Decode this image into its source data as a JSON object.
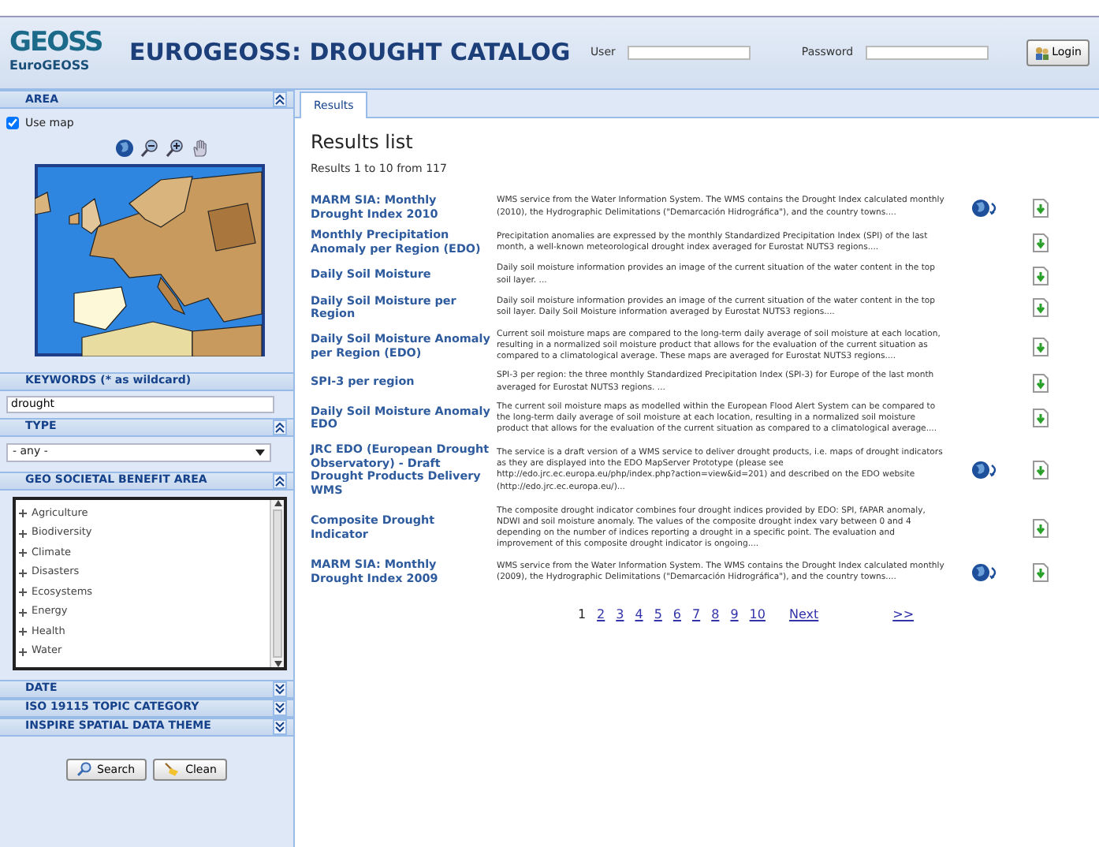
{
  "header": {
    "logo_text": "GEOSS",
    "logo_subtitle": "EuroGEOSS",
    "title": "EUROGEOSS: DROUGHT CATALOG",
    "user_label": "User",
    "password_label": "Password",
    "login_button": "Login"
  },
  "sidebar": {
    "area": {
      "title": "AREA",
      "expanded": true,
      "use_map_label": "Use map",
      "use_map_checked": true
    },
    "keywords": {
      "title": "KEYWORDS (* as wildcard)",
      "value": "drought"
    },
    "type": {
      "title": "TYPE",
      "expanded": true,
      "value": "- any -"
    },
    "benefit_area": {
      "title": "GEO SOCIETAL BENEFIT AREA",
      "expanded": true,
      "items": [
        {
          "label": "Agriculture",
          "expanded": false
        },
        {
          "label": "Biodiversity",
          "expanded": false
        },
        {
          "label": "Climate",
          "expanded": false
        },
        {
          "label": "Disasters",
          "expanded": false
        },
        {
          "label": "Ecosystems",
          "expanded": false
        },
        {
          "label": "Energy",
          "expanded": false
        },
        {
          "label": "Health",
          "expanded": false
        },
        {
          "label": "Water",
          "expanded": false
        }
      ]
    },
    "collapsed_panels": [
      {
        "title": "DATE",
        "expanded": false
      },
      {
        "title": "ISO 19115 TOPIC CATEGORY",
        "expanded": false
      },
      {
        "title": "INSPIRE SPATIAL DATA THEME",
        "expanded": false
      }
    ],
    "buttons": [
      "Search",
      "Clean"
    ]
  },
  "tabs": [
    {
      "label": "Results",
      "selected": true
    }
  ],
  "results": {
    "heading": "Results list",
    "summary": "Results 1 to 10 from 117",
    "rows": [
      {
        "title": "MARM SIA: Monthly Drought Index 2010",
        "description": "WMS service from the Water Information System. The WMS contains the Drought Index calculated monthly (2010), the Hydrographic Delimitations (\"Demarcación Hidrográfica\"), and the country towns....",
        "map_preview": true
      },
      {
        "title": "Monthly Precipitation Anomaly per Region (EDO)",
        "description": "Precipitation anomalies are expressed by the monthly Standardized Precipitation Index (SPI) of the last month, a well-known meteorological drought index averaged for Eurostat NUTS3 regions....",
        "map_preview": false
      },
      {
        "title": "Daily Soil Moisture",
        "description": "Daily soil moisture information provides an image of the current situation of the water content in the top soil layer. ...",
        "map_preview": false
      },
      {
        "title": "Daily Soil Moisture per Region",
        "description": "Daily soil moisture information provides an image of the current situation of the water content in the top soil layer. Daily Soil Moisture information averaged by Eurostat NUTS3 regions....",
        "map_preview": false
      },
      {
        "title": "Daily Soil Moisture Anomaly per Region (EDO)",
        "description": "Current soil moisture maps are compared to the long-term daily average of soil moisture at each location, resulting in a normalized soil moisture product that allows for the evaluation of the current situation as compared to a climatological average. These maps are averaged for Eurostat NUTS3 regions....",
        "map_preview": false
      },
      {
        "title": "SPI-3 per region",
        "description": "SPI-3 per region: the three monthly Standardized Precipitation Index (SPI-3) for Europe of the last month averaged for Eurostat NUTS3 regions. ...",
        "map_preview": false
      },
      {
        "title": "Daily Soil Moisture Anomaly EDO",
        "description": "The current soil moisture maps as modelled within the European Flood Alert System can be compared to the long-term daily average of soil moisture at each location, resulting in a normalized soil moisture product that allows for the evaluation of the current situation as compared to a climatological average....",
        "map_preview": false
      },
      {
        "title": "JRC EDO (European Drought Observatory) - Draft Drought Products Delivery WMS",
        "description": "The service is a draft version of a WMS service to deliver drought products, i.e. maps of drought indicators as they are displayed into the EDO MapServer Prototype (please see http://edo.jrc.ec.europa.eu/php/index.php?action=view&id=201) and described on the EDO website (http://edo.jrc.ec.europa.eu/)...",
        "map_preview": true
      },
      {
        "title": "Composite Drought Indicator",
        "description": "The composite drought indicator combines four drought indices provided by EDO: SPI, fAPAR anomaly, NDWI and soil moisture anomaly. The values of the composite drought index vary between 0 and 4 depending on the number of indices reporting a drought in a specific point. The evaluation and improvement of this composite drought indicator is ongoing....",
        "map_preview": false
      },
      {
        "title": "MARM SIA: Monthly Drought Index 2009",
        "description": "WMS service from the Water Information System. The WMS contains the Drought Index calculated monthly (2009), the Hydrographic Delimitations (\"Demarcación Hidrográfica\"), and the country towns....",
        "map_preview": true
      }
    ],
    "pages": [
      {
        "label": "1",
        "selected": true
      },
      {
        "label": "2",
        "selected": false
      },
      {
        "label": "3",
        "selected": false
      },
      {
        "label": "4",
        "selected": false
      },
      {
        "label": "5",
        "selected": false
      },
      {
        "label": "6",
        "selected": false
      },
      {
        "label": "7",
        "selected": false
      },
      {
        "label": "8",
        "selected": false
      },
      {
        "label": "9",
        "selected": false
      },
      {
        "label": "10",
        "selected": false
      }
    ],
    "next": "Next",
    "last": ">>"
  }
}
